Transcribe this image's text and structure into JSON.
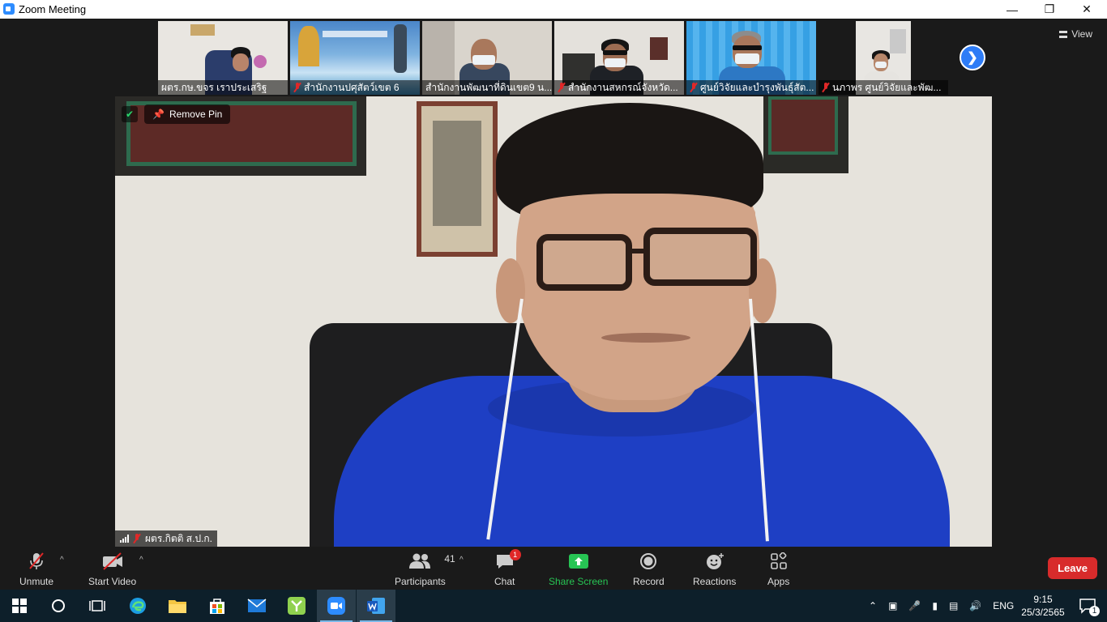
{
  "window": {
    "title": "Zoom Meeting",
    "minimize_glyph": "—",
    "maximize_glyph": "❐",
    "close_glyph": "✕"
  },
  "view_button": {
    "label": "View"
  },
  "thumbnails": [
    {
      "name": "ผตร.กษ.ขจร เราประเสริฐ",
      "muted": false
    },
    {
      "name": "สำนักงานปศุสัตว์เขต 6",
      "muted": true
    },
    {
      "name": "สำนักงานพัฒนาที่ดินเขต9 น...",
      "muted": false
    },
    {
      "name": "สำนักงานสหกรณ์จังหวัด...",
      "muted": true
    },
    {
      "name": "ศูนย์วิจัยและบำรุงพันธุ์สัต...",
      "muted": true
    },
    {
      "name": "นภาพร ศูนย์วิจัยและพัฒ...",
      "muted": true
    }
  ],
  "main_video": {
    "remove_pin_label": "Remove Pin",
    "speaker_name": "ผตร.กิตติ ส.ป.ก."
  },
  "toolbar": {
    "unmute_label": "Unmute",
    "start_video_label": "Start Video",
    "participants_label": "Participants",
    "participants_count": "41",
    "chat_label": "Chat",
    "chat_badge": "1",
    "share_screen_label": "Share Screen",
    "record_label": "Record",
    "reactions_label": "Reactions",
    "apps_label": "Apps",
    "leave_label": "Leave",
    "caret": "^"
  },
  "taskbar": {
    "language": "ENG",
    "time": "9:15",
    "date": "25/3/2565",
    "notification_count": "1"
  },
  "colors": {
    "accent_blue": "#2e7cf6",
    "leave_red": "#d82b2b",
    "share_green": "#27c454",
    "muted_red": "#e02828"
  }
}
